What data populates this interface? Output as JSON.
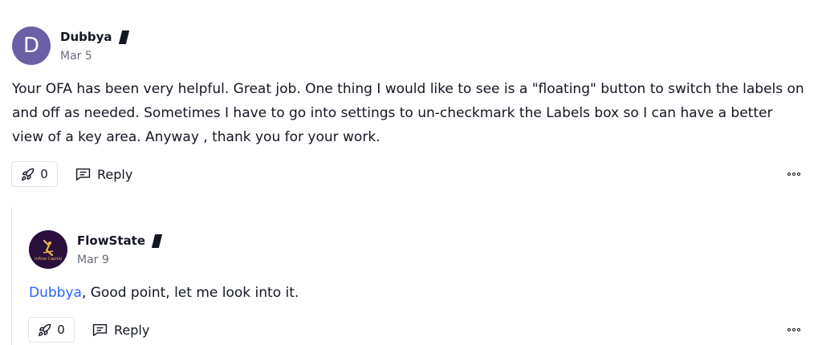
{
  "comment": {
    "avatar_letter": "D",
    "author": "Dubbya",
    "date": "Mar 5",
    "text": "Your OFA has been very helpful. Great job. One thing I would like to see is a \"floating\" button to switch the labels on and off as needed. Sometimes I have to go into settings to un-checkmark the Labels box so I can have a better view of a key area. Anyway , thank you for your work.",
    "boost_count": "0",
    "reply_label": "Reply"
  },
  "reply": {
    "avatar_text": "Inflow Capital",
    "author": "FlowState",
    "date": "Mar 9",
    "mention": "Dubbya",
    "text": ", Good point, let me look into it.",
    "boost_count": "0",
    "reply_label": "Reply"
  },
  "colors": {
    "avatar_bg": "#6b5fa8",
    "mention": "#2962ff",
    "logo_bg": "#2a0f3c"
  },
  "icons": {
    "boost": "rocket-icon",
    "reply": "comment-icon",
    "more": "more-horizontal-icon",
    "badge": "author-badge-icon"
  }
}
